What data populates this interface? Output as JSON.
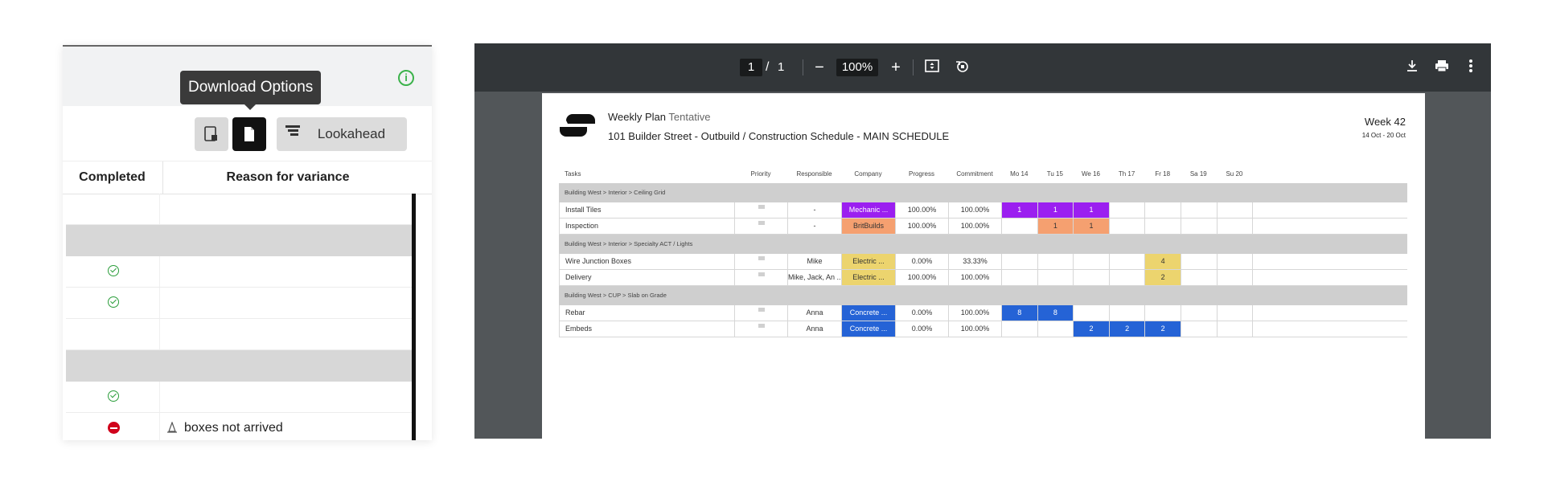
{
  "left_panel": {
    "tooltip": "Download Options",
    "lookahead_label": "Lookahead",
    "col_completed": "Completed",
    "col_reason": "Reason for variance",
    "rows": [
      {
        "type": "blank"
      },
      {
        "type": "group"
      },
      {
        "type": "done"
      },
      {
        "type": "done"
      },
      {
        "type": "blank"
      },
      {
        "type": "group"
      },
      {
        "type": "done"
      },
      {
        "type": "stop",
        "reason": "boxes not arrived"
      }
    ]
  },
  "pdf_toolbar": {
    "page_current": "1",
    "page_sep": "/",
    "page_total": "1",
    "zoom": "100%",
    "zoom_out": "−",
    "zoom_in": "+"
  },
  "doc": {
    "title": "Weekly Plan",
    "status": "Tentative",
    "subtitle": "101 Builder Street - Outbuild / Construction Schedule - MAIN SCHEDULE",
    "week": "Week 42",
    "week_range": "14 Oct - 20 Oct",
    "headers": {
      "tasks": "Tasks",
      "priority": "Priority",
      "responsible": "Responsible",
      "company": "Company",
      "progress": "Progress",
      "commitment": "Commitment",
      "days": [
        "Mo 14",
        "Tu 15",
        "We 16",
        "Th 17",
        "Fr 18",
        "Sa 19",
        "Su 20"
      ]
    },
    "groups": [
      {
        "path": "Building West > Interior > Ceiling Grid",
        "tasks": [
          {
            "name": "Install Tiles",
            "responsible": "-",
            "company": "Mechanic ...",
            "company_color": "#9b1ff0",
            "progress": "100.00%",
            "commitment": "100.00%",
            "days": [
              "1",
              "1",
              "1",
              "",
              "",
              "",
              ""
            ]
          },
          {
            "name": "Inspection",
            "responsible": "-",
            "company": "BritBuilds",
            "company_color": "#f5a070",
            "progress": "100.00%",
            "commitment": "100.00%",
            "days": [
              "",
              "1",
              "1",
              "",
              "",
              "",
              ""
            ]
          }
        ]
      },
      {
        "path": "Building West > Interior > Specialty ACT / Lights",
        "tasks": [
          {
            "name": "Wire Junction Boxes",
            "responsible": "Mike",
            "company": "Electric ...",
            "company_color": "#ecd46e",
            "progress": "0.00%",
            "commitment": "33.33%",
            "days": [
              "",
              "",
              "",
              "",
              "4",
              "",
              ""
            ]
          },
          {
            "name": "Delivery",
            "responsible": "Mike, Jack, An ...",
            "company": "Electric ...",
            "company_color": "#ecd46e",
            "progress": "100.00%",
            "commitment": "100.00%",
            "days": [
              "",
              "",
              "",
              "",
              "2",
              "",
              ""
            ]
          }
        ]
      },
      {
        "path": "Building West > CUP > Slab on Grade",
        "tasks": [
          {
            "name": "Rebar",
            "responsible": "Anna",
            "company": "Concrete ...",
            "company_color": "#2563d6",
            "progress": "0.00%",
            "commitment": "100.00%",
            "days": [
              "8",
              "8",
              "",
              "",
              "",
              "",
              ""
            ]
          },
          {
            "name": "Embeds",
            "responsible": "Anna",
            "company": "Concrete ...",
            "company_color": "#2563d6",
            "progress": "0.00%",
            "commitment": "100.00%",
            "days": [
              "",
              "",
              "2",
              "2",
              "2",
              "",
              ""
            ]
          }
        ]
      }
    ]
  }
}
